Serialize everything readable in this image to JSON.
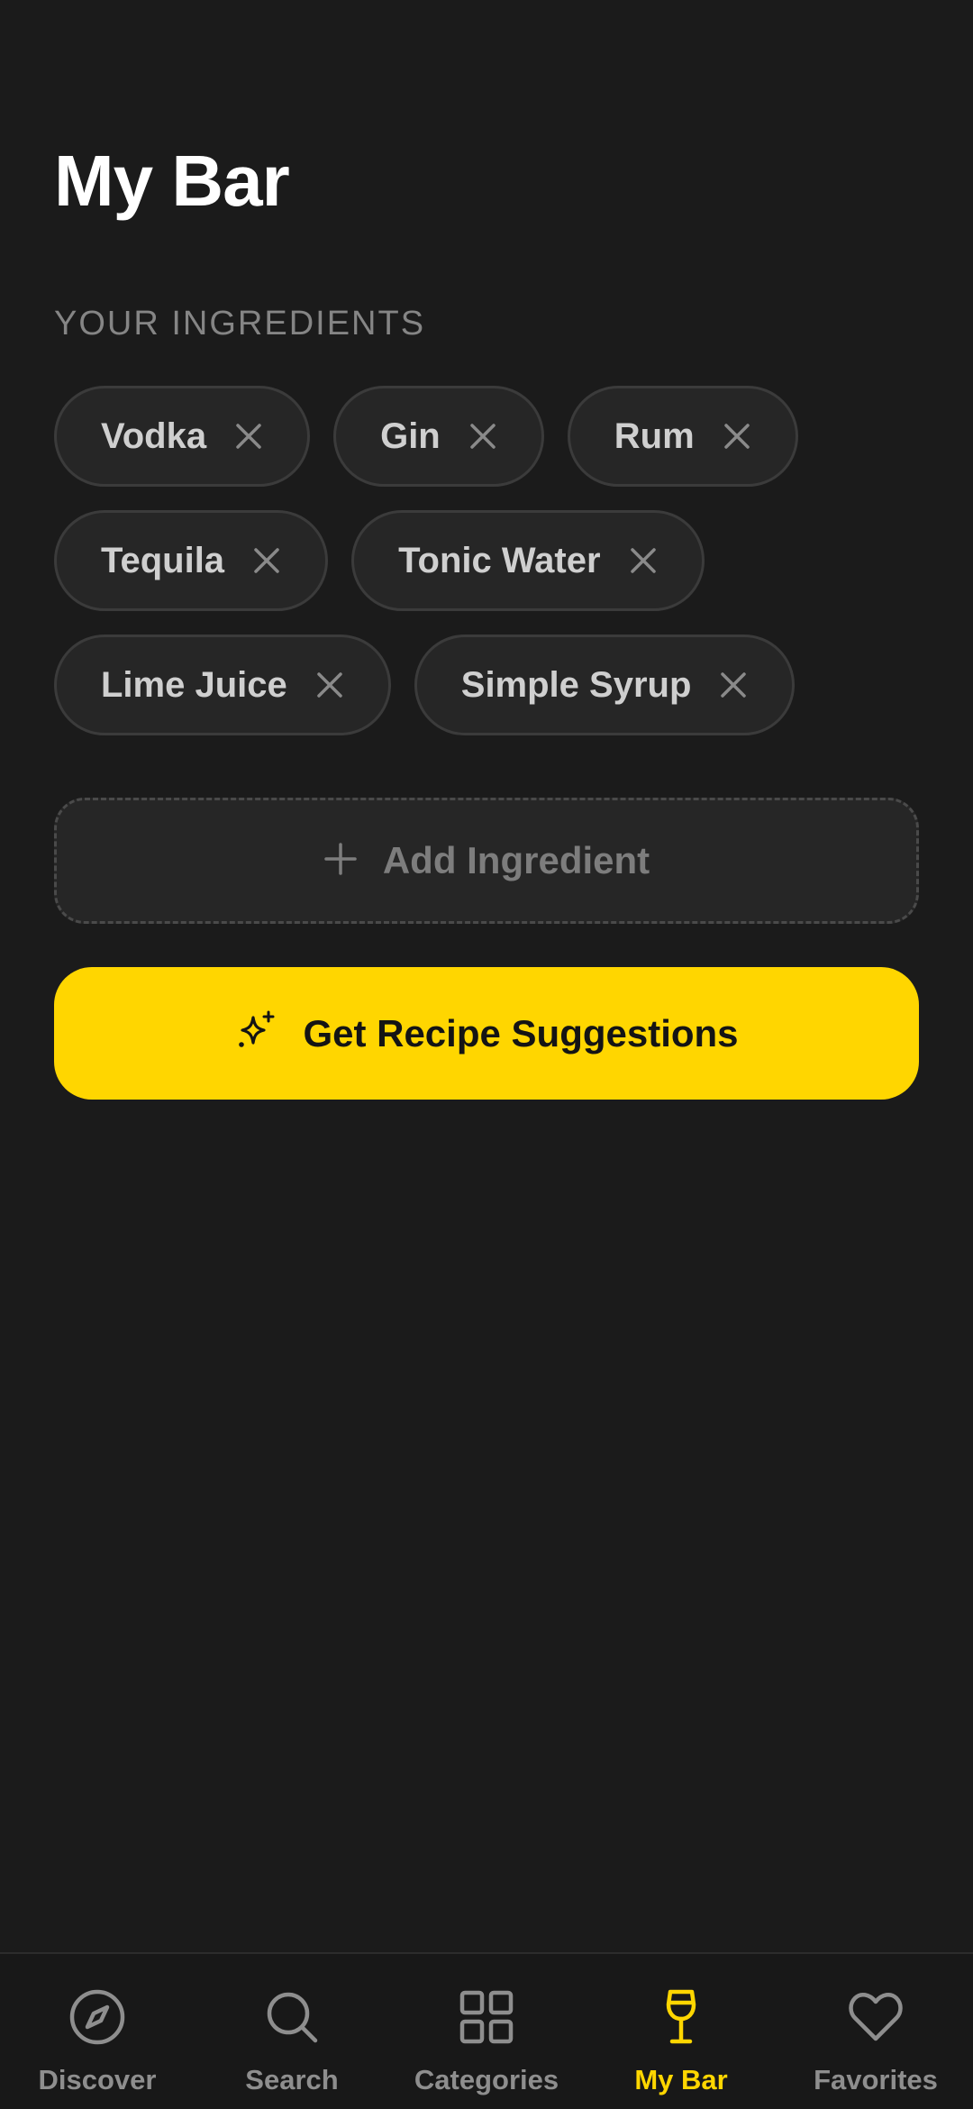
{
  "header": {
    "title": "My Bar"
  },
  "ingredients": {
    "section_label": "YOUR INGREDIENTS",
    "items": [
      {
        "label": "Vodka"
      },
      {
        "label": "Gin"
      },
      {
        "label": "Rum"
      },
      {
        "label": "Tequila"
      },
      {
        "label": "Tonic Water"
      },
      {
        "label": "Lime Juice"
      },
      {
        "label": "Simple Syrup"
      }
    ]
  },
  "actions": {
    "add_label": "Add Ingredient",
    "suggest_label": "Get Recipe Suggestions"
  },
  "nav": {
    "items": [
      {
        "label": "Discover",
        "icon": "compass-icon"
      },
      {
        "label": "Search",
        "icon": "search-icon"
      },
      {
        "label": "Categories",
        "icon": "grid-icon"
      },
      {
        "label": "My Bar",
        "icon": "wine-glass-icon",
        "active": true
      },
      {
        "label": "Favorites",
        "icon": "heart-icon"
      }
    ]
  },
  "colors": {
    "background": "#1b1b1b",
    "accent": "#ffd600",
    "chip_background": "#262626",
    "muted_text": "#858585"
  }
}
